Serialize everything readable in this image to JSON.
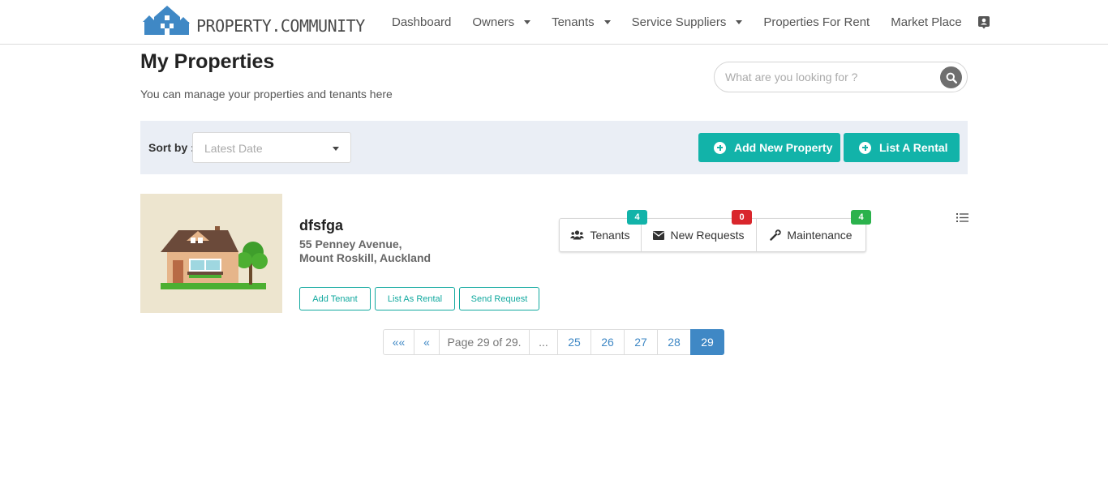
{
  "brand": {
    "name": "PROPERTY.COMMUNITY"
  },
  "nav": {
    "items": [
      {
        "label": "Dashboard",
        "dropdown": false
      },
      {
        "label": "Owners",
        "dropdown": true
      },
      {
        "label": "Tenants",
        "dropdown": true
      },
      {
        "label": "Service Suppliers",
        "dropdown": true
      },
      {
        "label": "Properties For Rent",
        "dropdown": false
      },
      {
        "label": "Market Place",
        "dropdown": false
      }
    ],
    "profile_icon": "contact-card-icon"
  },
  "page": {
    "title": "My Properties",
    "subtitle": "You can manage your properties and tenants here"
  },
  "search": {
    "placeholder": "What are you looking for ?",
    "icon": "search-icon"
  },
  "toolbar": {
    "sort_label": "Sort by :",
    "sort_value": "Latest Date",
    "add_property_label": "Add New Property",
    "list_rental_label": "List A Rental"
  },
  "property": {
    "name": "dfsfga",
    "address_line1": "55 Penney Avenue,",
    "address_line2": "Mount Roskill, Auckland",
    "actions": {
      "add_tenant": "Add Tenant",
      "list_as_rental": "List As Rental",
      "send_request": "Send Request"
    },
    "stats": [
      {
        "label": "Tenants",
        "count": "4",
        "icon": "users-icon",
        "badge_color": "#12b3a9"
      },
      {
        "label": "New Requests",
        "count": "0",
        "icon": "envelope-icon",
        "badge_color": "#d9262c"
      },
      {
        "label": "Maintenance",
        "count": "4",
        "icon": "wrench-icon",
        "badge_color": "#2bb24c"
      }
    ]
  },
  "pagination": {
    "first": "««",
    "prev": "«",
    "summary": "Page 29 of 29.",
    "ellipsis": "...",
    "pages": [
      "25",
      "26",
      "27",
      "28",
      "29"
    ],
    "current": "29"
  },
  "colors": {
    "accent": "#12b3a9",
    "link": "#3f88c5",
    "toolbar_bg": "#eaeef5"
  }
}
